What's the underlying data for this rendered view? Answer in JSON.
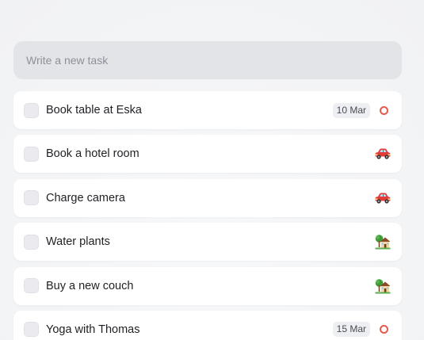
{
  "new_task": {
    "placeholder": "Write a new task",
    "value": ""
  },
  "tasks": [
    {
      "label": "Book table at Eska",
      "date": "10 Mar",
      "icon": "red-ring-icon",
      "checked": false
    },
    {
      "label": "Book a hotel room",
      "date": "",
      "icon": "car-icon",
      "checked": false
    },
    {
      "label": "Charge camera",
      "date": "",
      "icon": "car-icon",
      "checked": false
    },
    {
      "label": "Water plants",
      "date": "",
      "icon": "house-with-garden-icon",
      "checked": false
    },
    {
      "label": "Buy a new couch",
      "date": "",
      "icon": "house-with-garden-icon",
      "checked": false
    },
    {
      "label": "Yoga with Thomas",
      "date": "15 Mar",
      "icon": "red-ring-icon",
      "checked": false
    }
  ],
  "colors": {
    "accent_ring": "#e8584c",
    "card": "#ffffff",
    "input_bg": "#e3e4e8"
  }
}
